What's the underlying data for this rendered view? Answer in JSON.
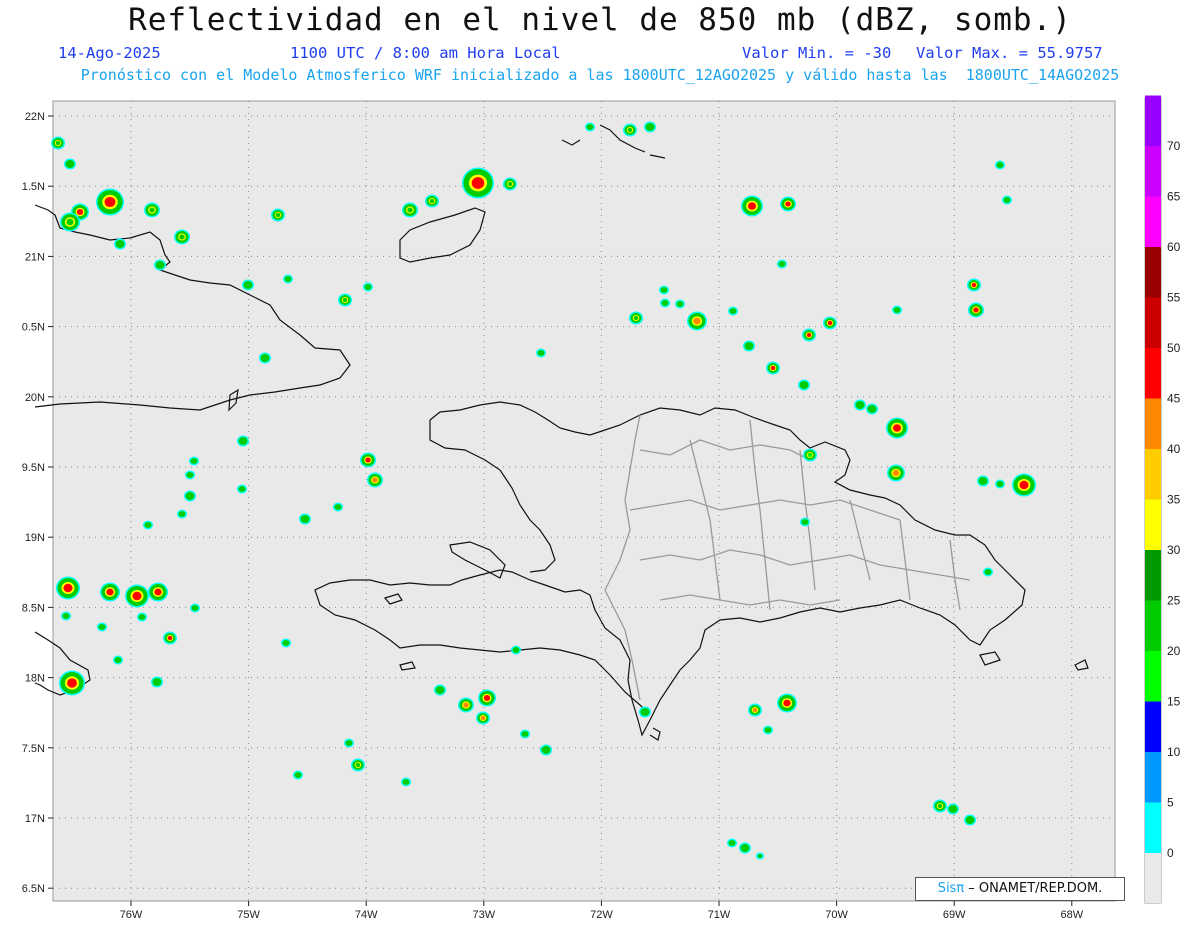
{
  "header": {
    "title": "Reflectividad en el nivel de 850 mb (dBZ, somb.)",
    "date": "14-Ago-2025",
    "time": "1100 UTC / 8:00 am Hora Local",
    "vmin": "Valor Min. = -30",
    "vmax": "Valor Max. = 55.9757",
    "model_line": "Pronóstico con el Modelo Atmosferico WRF inicializado a las 1800UTC_12AGO2025 y válido hasta las  1800UTC_14AGO2025"
  },
  "axes": {
    "lat_labels": [
      "22N",
      "1.5N",
      "21N",
      "0.5N",
      "20N",
      "9.5N",
      "19N",
      "8.5N",
      "18N",
      "7.5N",
      "17N",
      "6.5N"
    ],
    "lon_labels": [
      "76W",
      "75W",
      "74W",
      "73W",
      "72W",
      "71W",
      "70W",
      "69W",
      "68W"
    ]
  },
  "colorbar": {
    "labels": [
      "0",
      "5",
      "10",
      "15",
      "20",
      "25",
      "30",
      "35",
      "40",
      "45",
      "50",
      "55",
      "60",
      "65",
      "70"
    ],
    "colors": [
      "#00ffff",
      "#0099ff",
      "#0000ff",
      "#00ff00",
      "#00cc00",
      "#009900",
      "#ffff00",
      "#ffcc00",
      "#ff8800",
      "#ff0000",
      "#cc0000",
      "#990000",
      "#ff00ff",
      "#cc00ff",
      "#9900ff"
    ]
  },
  "credit": {
    "sis": "Sisπ",
    "org": " – ONAMET/REP.DOM."
  },
  "colors": {
    "map_bg": "#e9e9e9",
    "coast": "#111111",
    "provinces": "#9a9a9a",
    "grid": "#888888"
  }
}
